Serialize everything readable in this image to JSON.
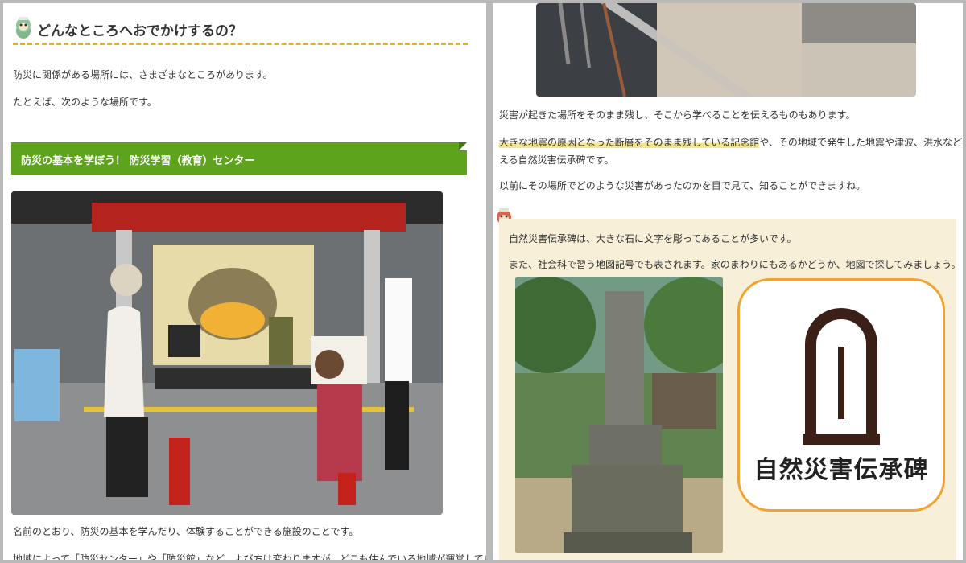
{
  "left": {
    "heading": "どんなところへおでかけするの？",
    "intro1": "防災に関係がある場所には、さまざまなところがあります。",
    "intro2": "たとえば、次のような場所です。",
    "section_title": "防災の基本を学ぼう！ 防災学習（教育）センター",
    "caption1": "名前のとおり、防災の基本を学んだり、体験することができる施設のことです。",
    "caption2": "地域によって「防災センター」や「防災館」など、よび方は変わりますが、どこも住んでいる地域が運営しています。"
  },
  "right": {
    "para1": "災害が起きた場所をそのまま残し、そこから学べることを伝えるものもあります。",
    "para2_highlight": "大きな地震の原因となった断層をそのまま残している記念館",
    "para2_rest": "や、その地域で発生した地震や津波、洪水などを伝",
    "para2_line2": "える自然災害伝承碑です。",
    "para3": "以前にその場所でどのような災害があったのかを目で見て、知ることができますね。",
    "box_para1": "自然災害伝承碑は、大きな石に文字を彫ってあることが多いです。",
    "box_para2": "また、社会科で習う地図記号でも表されます。家のまわりにもあるかどうか、地図で探してみましょう。",
    "symbol_label": "自然災害伝承碑"
  },
  "colors": {
    "green_bar": "#5da31c",
    "dashed_underline": "#e9b315",
    "beige_box": "#f7efd7",
    "symbol_border": "#f0a330"
  },
  "icons": [
    "mascot-icon",
    "map-symbol-icon"
  ]
}
